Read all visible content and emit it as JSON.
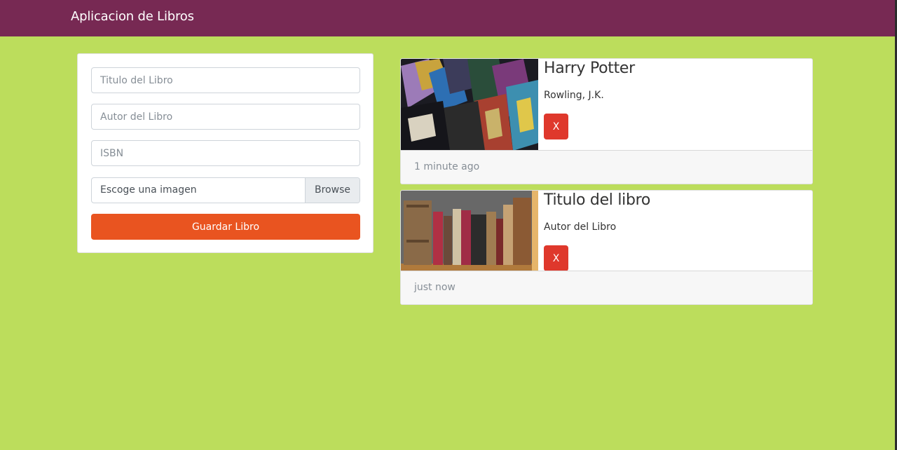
{
  "navbar": {
    "brand": "Aplicacion de Libros"
  },
  "form": {
    "title_placeholder": "Titulo del Libro",
    "author_placeholder": "Autor del Libro",
    "isbn_placeholder": "ISBN",
    "file_label": "Escoge una imagen",
    "browse_label": "Browse",
    "save_label": "Guardar Libro"
  },
  "books": [
    {
      "title": "Harry Potter",
      "author": "Rowling, J.K.",
      "delete_label": "X",
      "timestamp": "1 minute ago",
      "image": "harry-potter-books-photo"
    },
    {
      "title": "Titulo del libro",
      "author": "Autor del Libro",
      "delete_label": "X",
      "timestamp": "just now",
      "image": "old-books-shelf-photo"
    }
  ],
  "colors": {
    "navbar": "#772953",
    "background": "#bcdd5c",
    "primary": "#e95420",
    "danger": "#df382c"
  }
}
